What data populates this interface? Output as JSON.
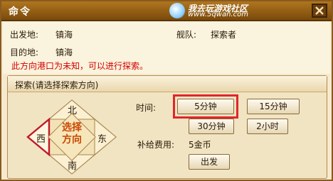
{
  "window": {
    "title": "命令",
    "watermark_line1": "我去玩游戏社区",
    "watermark_line2": "www.5qwan.com",
    "close_icon": "close-x-icon"
  },
  "info": {
    "departure_label": "出发地:",
    "departure_value": "镇海",
    "fleet_label": "舰队:",
    "fleet_value": "探索者",
    "destination_label": "目的地:",
    "destination_value": "镇海",
    "notice": "此方向港口为未知，可以进行探索。"
  },
  "explore": {
    "group_title": "探索(请选择探索方向)",
    "directions": {
      "north": "北",
      "south": "南",
      "east": "东",
      "west": "西"
    },
    "center_line1": "选择",
    "center_line2": "方向",
    "selected_direction": "west",
    "time_label": "时间:",
    "time_options": [
      "5分钟",
      "15分钟",
      "30分钟",
      "2小时"
    ],
    "selected_time": "5分钟",
    "cost_label": "补给费用:",
    "cost_value": "5金币",
    "depart_button": "出发"
  },
  "colors": {
    "title_bar": "#8b5a14",
    "notice_text": "#d40000",
    "selection_border": "#e0262a",
    "selected_arrow": "#c0182a"
  }
}
